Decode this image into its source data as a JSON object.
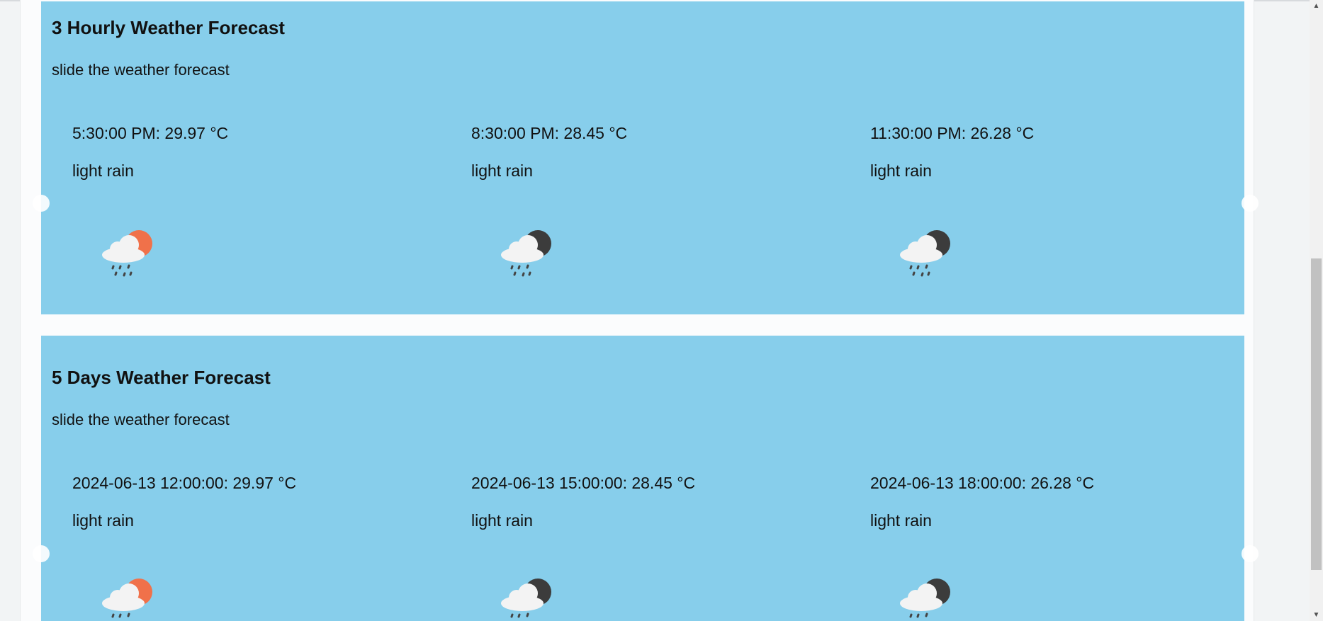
{
  "hourly": {
    "title": "3 Hourly Weather Forecast",
    "subtitle": "slide the weather forecast",
    "items": [
      {
        "temp": "5:30:00 PM: 29.97 °C",
        "desc": "light rain",
        "icon": "rain-sun-icon"
      },
      {
        "temp": "8:30:00 PM: 28.45 °C",
        "desc": "light rain",
        "icon": "rain-moon-icon"
      },
      {
        "temp": "11:30:00 PM: 26.28 °C",
        "desc": "light rain",
        "icon": "rain-moon-icon"
      }
    ]
  },
  "daily": {
    "title": "5 Days Weather Forecast",
    "subtitle": "slide the weather forecast",
    "items": [
      {
        "temp": "2024-06-13 12:00:00: 29.97 °C",
        "desc": "light rain",
        "icon": "rain-sun-icon"
      },
      {
        "temp": "2024-06-13 15:00:00: 28.45 °C",
        "desc": "light rain",
        "icon": "rain-moon-icon"
      },
      {
        "temp": "2024-06-13 18:00:00: 26.28 °C",
        "desc": "light rain",
        "icon": "rain-moon-icon"
      }
    ]
  },
  "colors": {
    "panel_bg": "#87ceeb",
    "sun": "#f0714a",
    "moon": "#3c3c3c",
    "cloud": "#f3f3f3"
  },
  "scrollbar": {
    "up_icon": "▲",
    "down_icon": "▼"
  }
}
